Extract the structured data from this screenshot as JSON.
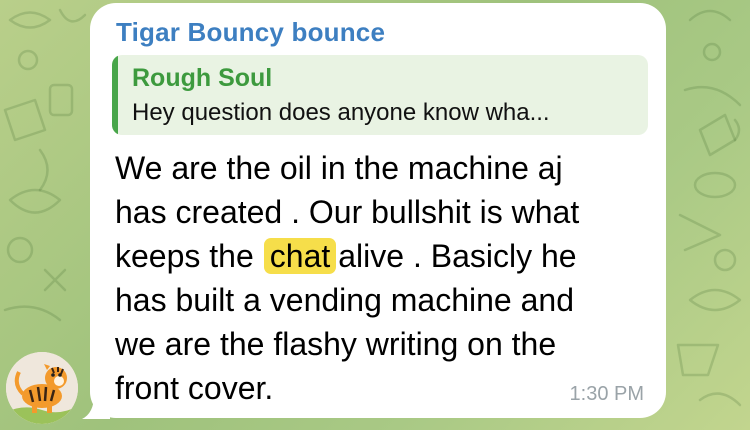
{
  "chat": {
    "wallpaper_color": "#a9c985",
    "bubble_color": "#ffffff"
  },
  "message": {
    "sender": "Tigar Bouncy bounce",
    "sender_color": "#3d7fc1",
    "reply": {
      "author": "Rough Soul",
      "preview": "Hey question does anyone know wha...",
      "accent_color": "#48a64a"
    },
    "lines": [
      "We are the oil in the machine aj",
      "has created . Our bullshit is what",
      "keeps the",
      "alive . Basicly he",
      "has built a vending machine and",
      "we are the flashy writing on the",
      "front cover."
    ],
    "highlighted_word": "chat",
    "highlight_color": "#f6de4a",
    "time": "1:30 PM"
  },
  "avatar": {
    "icon": "tigger-avatar-icon"
  }
}
